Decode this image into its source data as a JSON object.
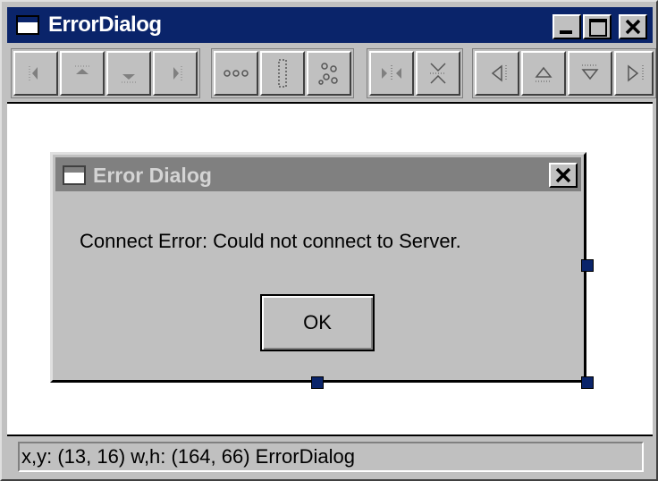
{
  "window": {
    "title": "ErrorDialog"
  },
  "toolbar": {
    "groups": [
      [
        "align-left-icon",
        "align-top-icon",
        "align-bottom-icon",
        "align-right-icon"
      ],
      [
        "space-horizontal-icon",
        "space-vertical-icon",
        "center-icon"
      ],
      [
        "center-horizontal-icon",
        "center-vertical-icon"
      ],
      [
        "move-left-icon",
        "move-up-icon",
        "move-down-icon",
        "move-right-icon"
      ]
    ]
  },
  "dialog": {
    "title": "Error Dialog",
    "message": "Connect Error:  Could not connect to Server.",
    "ok_label": "OK"
  },
  "status": {
    "text": "x,y: (13, 16)  w,h: (164, 66)  ErrorDialog"
  },
  "colors": {
    "titlebar_active": "#0a246a",
    "titlebar_inactive": "#808080",
    "face": "#c0c0c0",
    "handle": "#0a246a"
  }
}
